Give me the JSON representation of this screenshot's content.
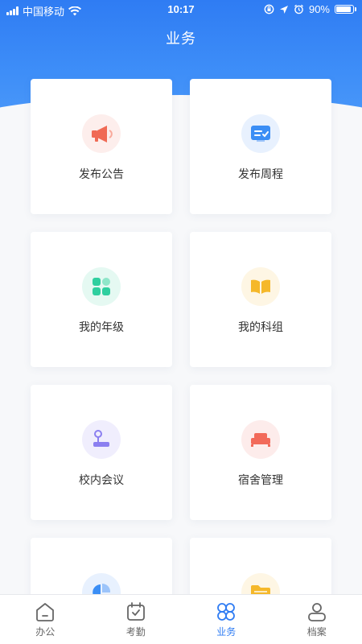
{
  "status_bar": {
    "carrier": "中国移动",
    "time": "10:17",
    "battery": "90%"
  },
  "header": {
    "title": "业务"
  },
  "cards": [
    {
      "label": "发布公告",
      "icon": "megaphone-icon",
      "color": "#f06a55"
    },
    {
      "label": "发布周程",
      "icon": "schedule-icon",
      "color": "#3b8ef5"
    },
    {
      "label": "我的年级",
      "icon": "grade-icon",
      "color": "#2fcf9f"
    },
    {
      "label": "我的科组",
      "icon": "book-icon",
      "color": "#f5b82a"
    },
    {
      "label": "校内会议",
      "icon": "meeting-icon",
      "color": "#8b7ff0"
    },
    {
      "label": "宿舍管理",
      "icon": "dormitory-icon",
      "color": "#f26a5a"
    },
    {
      "label": "",
      "icon": "pie-chart-icon",
      "color": "#3b8ef5"
    },
    {
      "label": "",
      "icon": "folder-icon",
      "color": "#f5b82a"
    }
  ],
  "tabbar": {
    "items": [
      {
        "label": "办公",
        "icon": "office-icon"
      },
      {
        "label": "考勤",
        "icon": "attendance-icon"
      },
      {
        "label": "业务",
        "icon": "business-icon",
        "active": true
      },
      {
        "label": "档案",
        "icon": "profile-icon"
      }
    ],
    "active_color": "#2f7cf3"
  }
}
